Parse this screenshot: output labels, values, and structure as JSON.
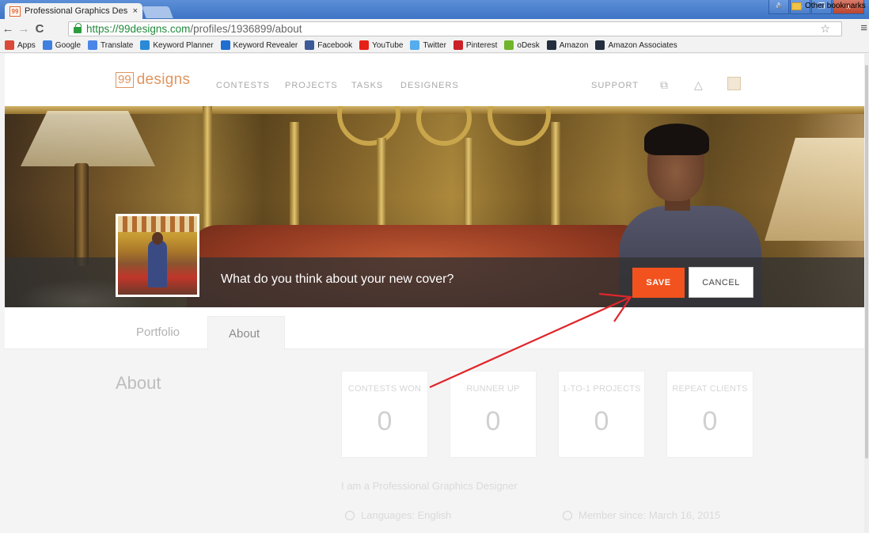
{
  "browser": {
    "tab_title": "Professional Graphics Des",
    "tab_close": "×",
    "favicon_text": "99",
    "url_scheme": "https://",
    "url_host": "99designs.com",
    "url_path": "/profiles/1936899/about",
    "window_buttons": [
      "≗",
      "–",
      "❐",
      "x"
    ]
  },
  "bookmarks": [
    {
      "label": "Apps",
      "icon": "apps-grid-icon",
      "color": "#d94a38"
    },
    {
      "label": "Google",
      "icon": "google-icon",
      "color": "#3f7fe0"
    },
    {
      "label": "Translate",
      "icon": "translate-icon",
      "color": "#4a86e8"
    },
    {
      "label": "Keyword Planner",
      "icon": "keyword-planner-icon",
      "color": "#2b8ad8"
    },
    {
      "label": "Keyword Revealer",
      "icon": "keyword-revealer-icon",
      "color": "#1f6fd0"
    },
    {
      "label": "Facebook",
      "icon": "facebook-icon",
      "color": "#3b5998"
    },
    {
      "label": "YouTube",
      "icon": "youtube-icon",
      "color": "#e62117"
    },
    {
      "label": "Twitter",
      "icon": "twitter-icon",
      "color": "#55acee"
    },
    {
      "label": "Pinterest",
      "icon": "pinterest-icon",
      "color": "#cb2027"
    },
    {
      "label": "oDesk",
      "icon": "odesk-icon",
      "color": "#6fb52c"
    },
    {
      "label": "Amazon",
      "icon": "amazon-icon",
      "color": "#232f3e"
    },
    {
      "label": "Amazon Associates",
      "icon": "amazon-icon",
      "color": "#232f3e"
    }
  ],
  "bookmarks_more": "»",
  "bookmarks_other": "Other bookmarks",
  "site": {
    "logo_box": "99",
    "logo_text": "designs",
    "nav": [
      "CONTESTS",
      "PROJECTS",
      "TASKS",
      "DESIGNERS"
    ],
    "support": "SUPPORT",
    "accent_color": "#f2521e"
  },
  "cover": {
    "message": "What do you think about your new cover?",
    "save": "SAVE",
    "cancel": "CANCEL"
  },
  "tabs": {
    "portfolio": "Portfolio",
    "about": "About"
  },
  "about": {
    "title": "About",
    "stats": [
      {
        "label": "CONTESTS WON",
        "value": "0"
      },
      {
        "label": "RUNNER UP",
        "value": "0"
      },
      {
        "label": "1-TO-1 PROJECTS",
        "value": "0"
      },
      {
        "label": "REPEAT CLIENTS",
        "value": "0"
      }
    ],
    "bio": "I am a Professional Graphics Designer",
    "languages": "Languages: English",
    "member_since": "Member since: March 16, 2015"
  }
}
